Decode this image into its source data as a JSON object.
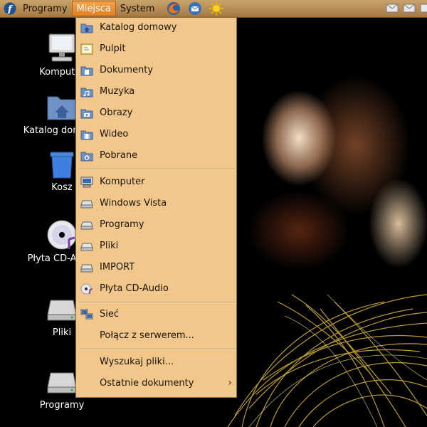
{
  "top_panel": {
    "menus": [
      "Programy",
      "Miejsca",
      "System"
    ],
    "active_menu": "Miejsca",
    "launchers": [
      "firefox-icon",
      "thunderbird-icon",
      "weather-sun-icon"
    ]
  },
  "desktop": {
    "icons": [
      {
        "label": "Komputer",
        "icon": "computer-icon"
      },
      {
        "label": "Katalog domowy",
        "icon": "home-folder-icon"
      },
      {
        "label": "Kosz",
        "icon": "trash-icon"
      },
      {
        "label": "Płyta CD-Audio",
        "icon": "cd-audio-icon"
      },
      {
        "label": "Pliki",
        "icon": "hard-drive-icon"
      },
      {
        "label": "Programy",
        "icon": "hard-drive-icon"
      }
    ]
  },
  "places_menu": {
    "items": [
      {
        "label": "Katalog domowy",
        "icon": "home-folder-icon"
      },
      {
        "label": "Pulpit",
        "icon": "desktop-icon"
      },
      {
        "label": "Dokumenty",
        "icon": "documents-folder-icon"
      },
      {
        "label": "Muzyka",
        "icon": "music-folder-icon"
      },
      {
        "label": "Obrazy",
        "icon": "pictures-folder-icon"
      },
      {
        "label": "Wideo",
        "icon": "video-folder-icon"
      },
      {
        "label": "Pobrane",
        "icon": "downloads-folder-icon"
      },
      {
        "label": "Komputer",
        "icon": "computer-icon"
      },
      {
        "label": "Windows Vista",
        "icon": "drive-icon"
      },
      {
        "label": "Programy",
        "icon": "drive-icon"
      },
      {
        "label": "Pliki",
        "icon": "drive-icon"
      },
      {
        "label": "IMPORT",
        "icon": "drive-icon"
      },
      {
        "label": "Płyta CD-Audio",
        "icon": "cd-audio-icon"
      },
      {
        "label": "Sieć",
        "icon": "network-icon"
      },
      {
        "label": "Połącz z serwerem...",
        "icon": ""
      },
      {
        "label": "Wyszukaj pliki...",
        "icon": ""
      },
      {
        "label": "Ostatnie dokumenty",
        "icon": ""
      }
    ]
  },
  "colors": {
    "panel": "#b78a52",
    "menu_bg": "#f2c78b",
    "active": "#e88b33"
  }
}
